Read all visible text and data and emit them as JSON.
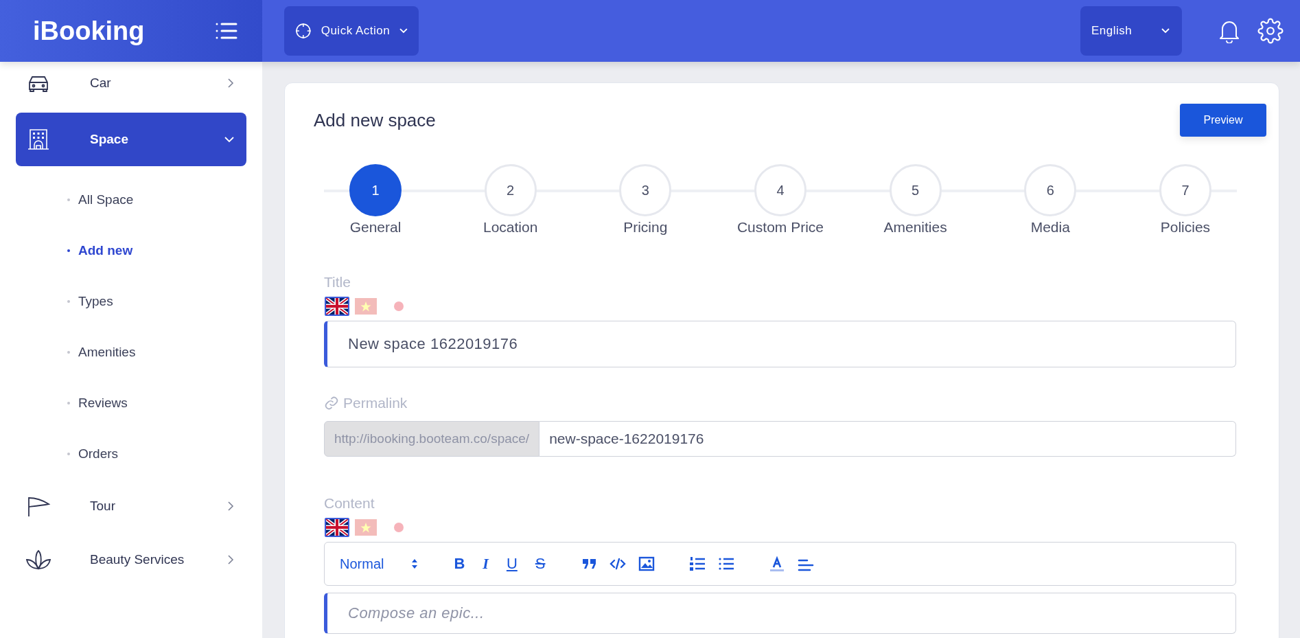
{
  "brand": "iBooking",
  "topbar": {
    "quick_action": "Quick Action",
    "language": "English"
  },
  "sidebar": {
    "items": [
      {
        "label": "Car",
        "kind": "car",
        "expanded": false,
        "selected": false
      },
      {
        "label": "Space",
        "kind": "building",
        "expanded": true,
        "selected": true,
        "children": [
          {
            "label": "All Space",
            "selected": false
          },
          {
            "label": "Add new",
            "selected": true
          },
          {
            "label": "Types",
            "selected": false
          },
          {
            "label": "Amenities",
            "selected": false
          },
          {
            "label": "Reviews",
            "selected": false
          },
          {
            "label": "Orders",
            "selected": false
          }
        ]
      },
      {
        "label": "Tour",
        "kind": "flag",
        "expanded": false,
        "selected": false
      },
      {
        "label": "Beauty Services",
        "kind": "lotus",
        "expanded": false,
        "selected": false
      }
    ]
  },
  "page": {
    "title": "Add new space",
    "preview_button": "Preview"
  },
  "steps": [
    {
      "number": "1",
      "label": "General",
      "selected": true
    },
    {
      "number": "2",
      "label": "Location",
      "selected": false
    },
    {
      "number": "3",
      "label": "Pricing",
      "selected": false
    },
    {
      "number": "4",
      "label": "Custom Price",
      "selected": false
    },
    {
      "number": "5",
      "label": "Amenities",
      "selected": false
    },
    {
      "number": "6",
      "label": "Media",
      "selected": false
    },
    {
      "number": "7",
      "label": "Policies",
      "selected": false
    }
  ],
  "title_field": {
    "label": "Title",
    "languages": [
      {
        "kind": "uk",
        "selected": true
      },
      {
        "kind": "vn",
        "selected": false
      }
    ],
    "value": "New space 1622019176"
  },
  "permalink": {
    "label": "Permalink",
    "prefix": "http://ibooking.booteam.co/space/",
    "value": "new-space-1622019176"
  },
  "content": {
    "label": "Content",
    "languages": [
      {
        "kind": "uk",
        "selected": true
      },
      {
        "kind": "vn",
        "selected": false
      }
    ],
    "toolbar": {
      "format": "Normal",
      "buttons": [
        {
          "kind": "bold",
          "text": "B"
        },
        {
          "kind": "italic",
          "text": "I"
        },
        {
          "kind": "underline",
          "text": "U"
        },
        {
          "kind": "strike",
          "text": "S"
        }
      ]
    },
    "placeholder": "Compose an epic..."
  }
}
